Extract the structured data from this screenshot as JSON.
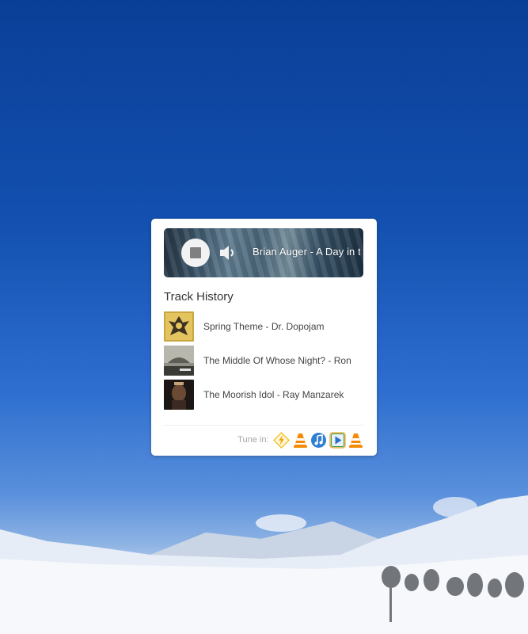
{
  "player": {
    "now_playing": "Brian Auger - A Day in the Life",
    "stop_button_label": "Stop",
    "volume_icon": "volume-icon"
  },
  "history": {
    "title": "Track History",
    "tracks": [
      {
        "label": "Spring Theme - Dr. Dopojam",
        "thumb_color": "#c9a644"
      },
      {
        "label": "The Middle Of Whose Night? - Ron",
        "thumb_color": "#8f8f86"
      },
      {
        "label": "The Moorish Idol - Ray Manzarek",
        "thumb_color": "#3a2a22"
      }
    ]
  },
  "tunein": {
    "label": "Tune in:",
    "players": [
      "winamp-icon",
      "vlc-icon",
      "itunes-icon",
      "windows-media-player-icon",
      "vlc-icon"
    ]
  },
  "colors": {
    "sky_top": "#0a3f97",
    "sky_bottom": "#5a90dc",
    "card_bg": "#ffffff",
    "text": "#333333"
  }
}
